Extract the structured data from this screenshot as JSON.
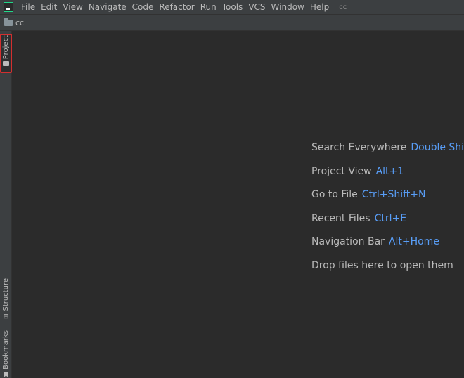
{
  "menubar": {
    "items": [
      "File",
      "Edit",
      "View",
      "Navigate",
      "Code",
      "Refactor",
      "Run",
      "Tools",
      "VCS",
      "Window",
      "Help"
    ],
    "window_title": "cc"
  },
  "navbar": {
    "project_name": "cc"
  },
  "tool_stripe": {
    "project_label": "Project",
    "structure_label": "Structure",
    "bookmarks_label": "Bookmarks"
  },
  "editor_hints": [
    {
      "label": "Search Everywhere",
      "shortcut": "Double Shift"
    },
    {
      "label": "Project View",
      "shortcut": "Alt+1"
    },
    {
      "label": "Go to File",
      "shortcut": "Ctrl+Shift+N"
    },
    {
      "label": "Recent Files",
      "shortcut": "Ctrl+E"
    },
    {
      "label": "Navigation Bar",
      "shortcut": "Alt+Home"
    },
    {
      "label": "Drop files here to open them",
      "shortcut": ""
    }
  ],
  "colors": {
    "background": "#2b2b2b",
    "chrome": "#3c3f41",
    "shortcut": "#589df6",
    "highlight_border": "#d32f2f"
  },
  "icons": {
    "app": "intellij-app-icon",
    "project_folder": "folder-icon",
    "structure": "structure-icon",
    "bookmarks": "bookmark-icon"
  }
}
